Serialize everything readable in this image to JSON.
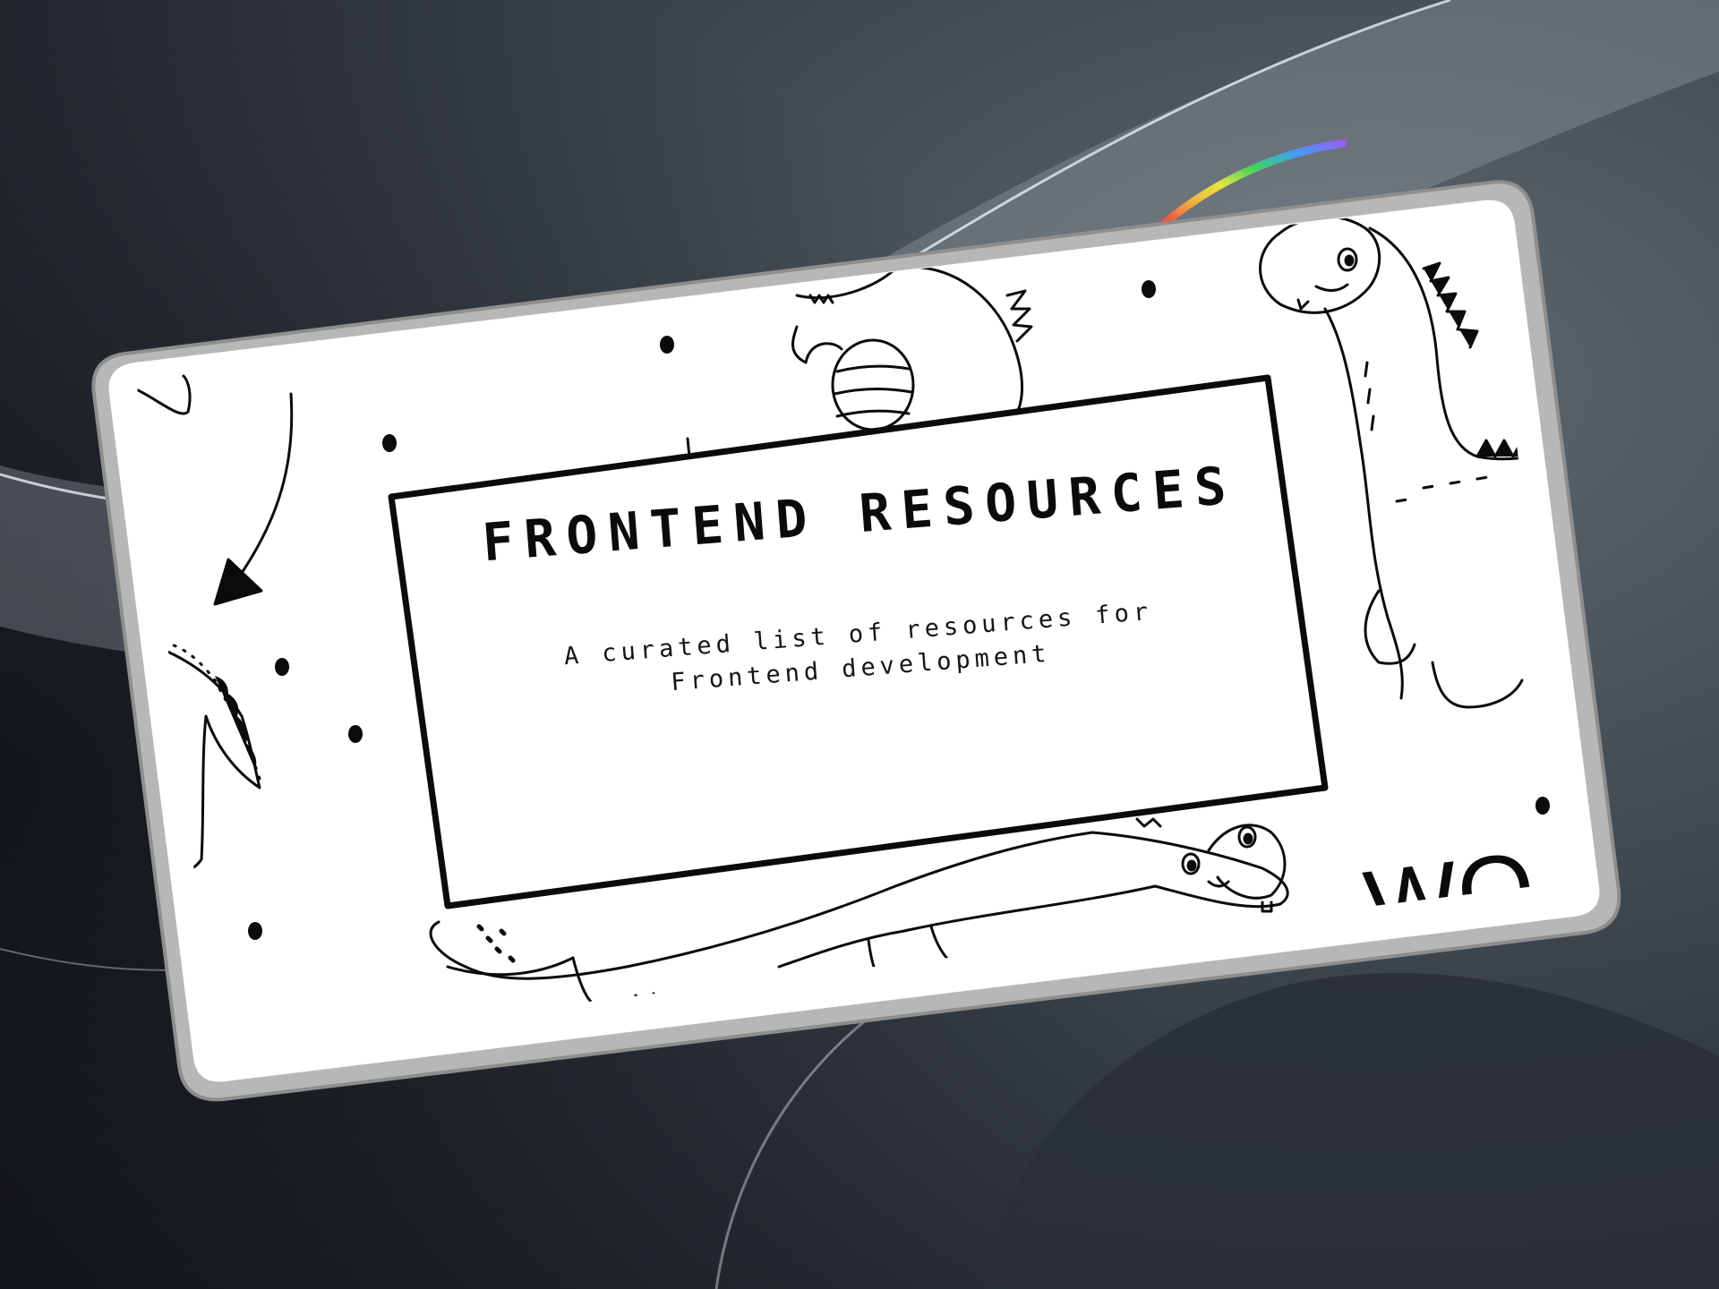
{
  "banner": {
    "title": "FRONTEND RESOURCES",
    "subtitle_line1": "A curated list of resources for",
    "subtitle_line2": "Frontend development",
    "partial_text": "WO"
  },
  "colors": {
    "background": "#3a4048",
    "card_border": "#a5a5a5",
    "card_fill": "#ffffff",
    "ink": "#0b0b0b"
  },
  "icons": [
    "dinosaur-doodle",
    "arrow-doodle",
    "dot-doodle",
    "rainbow-glint"
  ]
}
